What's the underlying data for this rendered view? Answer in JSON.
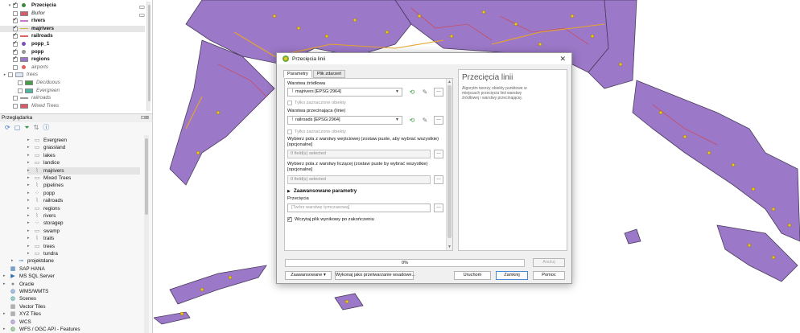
{
  "layers_panel": {
    "items": [
      {
        "label": "Przecięcia",
        "checked": true,
        "symbol": "dot",
        "color": "#3c8a3c",
        "style": "b",
        "indent": 1,
        "expand": "▾"
      },
      {
        "label": "Bufor",
        "checked": false,
        "symbol": "fill",
        "color": "#d65c6b",
        "style": "ib",
        "indent": 1,
        "expand": ""
      },
      {
        "label": "rivers",
        "checked": true,
        "symbol": "line",
        "color": "#d64040",
        "style": "b",
        "indent": 1,
        "expand": ""
      },
      {
        "label": "majrivers",
        "checked": true,
        "symbol": "line",
        "color": "#e8a628",
        "style": "b",
        "indent": 1,
        "expand": "",
        "selected": true
      },
      {
        "label": "railroads",
        "checked": true,
        "symbol": "line",
        "color": "#c878c8",
        "style": "b",
        "indent": 1,
        "expand": ""
      },
      {
        "label": "popp_1",
        "checked": true,
        "symbol": "dot",
        "color": "#7b52b8",
        "style": "b",
        "indent": 1,
        "expand": ""
      },
      {
        "label": "popp",
        "checked": true,
        "symbol": "dot",
        "color": "#d6b13a",
        "style": "b",
        "indent": 1,
        "expand": ""
      },
      {
        "label": "regions",
        "checked": true,
        "symbol": "fill",
        "color": "#9b78c8",
        "style": "b",
        "indent": 1,
        "expand": ""
      },
      {
        "label": "airports",
        "checked": false,
        "symbol": "dot",
        "color": "#e06060",
        "style": "i",
        "indent": 1,
        "expand": ""
      },
      {
        "label": "trees",
        "checked": false,
        "symbol": "dom",
        "color": "#dde6ee",
        "style": "i",
        "indent": 0,
        "expand": "▸"
      },
      {
        "label": "Deciduous",
        "checked": false,
        "symbol": "fill",
        "color": "#4a9a4a",
        "style": "i",
        "indent": 2,
        "expand": ""
      },
      {
        "label": "Evergreen",
        "checked": false,
        "symbol": "fill",
        "color": "#4fb4a0",
        "style": "i",
        "indent": 2,
        "expand": ""
      },
      {
        "label": "railroads",
        "checked": false,
        "symbol": "line",
        "color": "#999999",
        "style": "i",
        "indent": 1,
        "expand": ""
      },
      {
        "label": "Mixed Trees",
        "checked": false,
        "symbol": "fill",
        "color": "#d65c6b",
        "style": "i",
        "indent": 1,
        "expand": ""
      }
    ]
  },
  "browser_panel": {
    "title": "Przeglądarka",
    "tools": [
      "⟳",
      "▢",
      "⏷",
      "⇅",
      "ⓘ"
    ],
    "controls": "⊡⊠",
    "items": [
      {
        "label": "Evergreen",
        "icon": "▭",
        "icon_class": "",
        "indent": 3,
        "expand": "▸"
      },
      {
        "label": "grassland",
        "icon": "▭",
        "icon_class": "",
        "indent": 3,
        "expand": "▸"
      },
      {
        "label": "lakes",
        "icon": "▭",
        "icon_class": "",
        "indent": 3,
        "expand": "▸"
      },
      {
        "label": "landice",
        "icon": "▭",
        "icon_class": "",
        "indent": 3,
        "expand": "▸"
      },
      {
        "label": "majrivers",
        "icon": "⌇",
        "icon_class": "",
        "indent": 3,
        "expand": "▸",
        "selected": true
      },
      {
        "label": "Mixed Trees",
        "icon": "▭",
        "icon_class": "",
        "indent": 3,
        "expand": "▸"
      },
      {
        "label": "pipelines",
        "icon": "⌇",
        "icon_class": "",
        "indent": 3,
        "expand": "▸"
      },
      {
        "label": "popp",
        "icon": "⁘",
        "icon_class": "",
        "indent": 3,
        "expand": "▸"
      },
      {
        "label": "railroads",
        "icon": "⌇",
        "icon_class": "",
        "indent": 3,
        "expand": "▸"
      },
      {
        "label": "regions",
        "icon": "▭",
        "icon_class": "",
        "indent": 3,
        "expand": "▸"
      },
      {
        "label": "rivers",
        "icon": "⌇",
        "icon_class": "",
        "indent": 3,
        "expand": "▸"
      },
      {
        "label": "storagep",
        "icon": "⁘",
        "icon_class": "",
        "indent": 3,
        "expand": "▸"
      },
      {
        "label": "swamp",
        "icon": "▭",
        "icon_class": "",
        "indent": 3,
        "expand": "▸"
      },
      {
        "label": "trails",
        "icon": "⌇",
        "icon_class": "",
        "indent": 3,
        "expand": "▸"
      },
      {
        "label": "trees",
        "icon": "▭",
        "icon_class": "",
        "indent": 3,
        "expand": "▸"
      },
      {
        "label": "tundra",
        "icon": "▭",
        "icon_class": "",
        "indent": 3,
        "expand": "▸"
      },
      {
        "label": "projektdane",
        "icon": "⊸",
        "icon_class": "blue",
        "indent": 1,
        "expand": "▸"
      },
      {
        "label": "SAP HANA",
        "icon": "▦",
        "icon_class": "blue",
        "indent": 0,
        "expand": ""
      },
      {
        "label": "MS SQL Server",
        "icon": "▶",
        "icon_class": "blue",
        "indent": 0,
        "expand": "▸"
      },
      {
        "label": "Oracle",
        "icon": "●",
        "icon_class": "",
        "indent": 0,
        "expand": "▸"
      },
      {
        "label": "WMS/WMTS",
        "icon": "◍",
        "icon_class": "blue",
        "indent": 0,
        "expand": ""
      },
      {
        "label": "Scenes",
        "icon": "◍",
        "icon_class": "teal",
        "indent": 0,
        "expand": ""
      },
      {
        "label": "Vector Tiles",
        "icon": "▦",
        "icon_class": "",
        "indent": 0,
        "expand": ""
      },
      {
        "label": "XYZ Tiles",
        "icon": "▦",
        "icon_class": "",
        "indent": 0,
        "expand": "▸"
      },
      {
        "label": "WCS",
        "icon": "◍",
        "icon_class": "purple",
        "indent": 0,
        "expand": ""
      },
      {
        "label": "WFS / OGC API - Features",
        "icon": "◍",
        "icon_class": "green",
        "indent": 0,
        "expand": "▸"
      }
    ]
  },
  "dialog": {
    "title": "Przecięcia linii",
    "close_glyph": "✕",
    "tabs": [
      "Parametry",
      "Plik zdarzeń"
    ],
    "source_label": "Warstwa źródłowa",
    "source_value": "majrivers [EPSG:2964]",
    "selected_only_1": "Tylko zaznaczone obiekty",
    "intersect_label": "Warstwa przecinająca (linie)",
    "intersect_value": "railroads [EPSG:2964]",
    "selected_only_2": "Tylko zaznaczone obiekty",
    "input_fields_label": "Wybierz pola z warstwy wejściowej (zostaw puste, aby wybrać wszystkie) [opcjonalne]",
    "input_fields_value": "0 field(s) selected",
    "intersect_fields_label": "Wybierz pola z warstwy liczącej (zostaw puste by wybrać wszystkie) [opcjonalne]",
    "intersect_fields_value": "0 field(s) selected",
    "advanced_label": "Zaawansowane parametry",
    "output_label": "Przecięcia",
    "output_placeholder": "[Twórz warstwę tymczasową]",
    "open_file_label": "Wczytaj plik wynikowy po zakończeniu",
    "help_title": "Przecięcia linii",
    "help_text": "Algorytm tworzy obiekty punktowe w miejscach przecięcia linii warstwy źródłowej i warstwy przecinającej.",
    "progress_text": "0%",
    "progress_value": 0,
    "cancel_label": "Anuluj",
    "advanced_button": "Zaawansowane ▾",
    "batch_button": "Wykonaj jako przetwarzanie wsadowe...",
    "run_button": "Uruchom",
    "close_button": "Zamknij",
    "help_button": "Pomoc"
  }
}
